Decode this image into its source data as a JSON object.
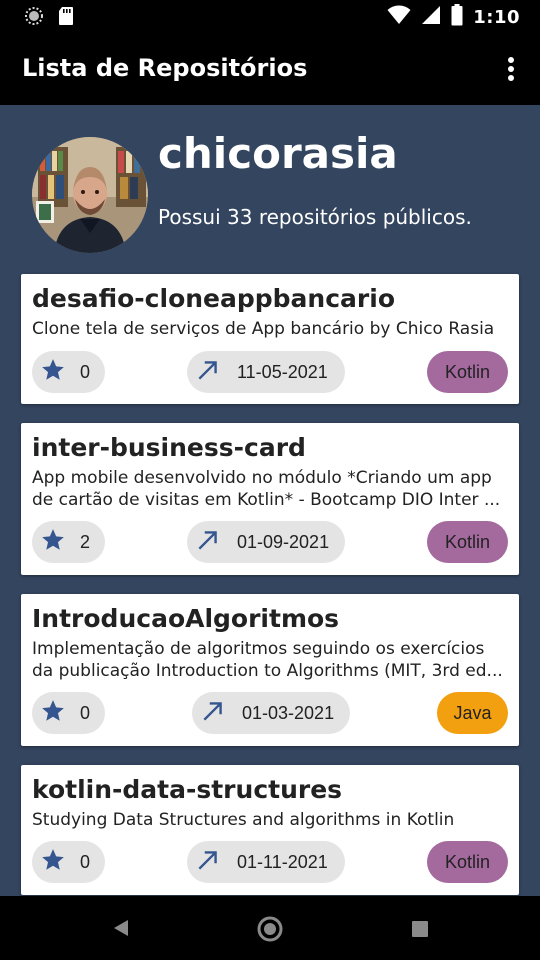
{
  "status_bar": {
    "time": "1:10",
    "icons": [
      "record-circle-icon",
      "sd-card-icon",
      "wifi-icon",
      "signal-icon",
      "battery-icon"
    ]
  },
  "app_bar": {
    "title": "Lista de Repositórios",
    "menu_icon": "more-vert-icon"
  },
  "profile": {
    "username": "chicorasia",
    "repo_count_text": "Possui 33 repositórios públicos."
  },
  "colors": {
    "background": "#34455f",
    "star": "#34558f",
    "kotlin": "#a46a9e",
    "java": "#f29f10",
    "chip_grey": "#e4e4e4"
  },
  "repos": [
    {
      "name": "desafio-cloneappbancario",
      "description": "Clone tela de serviços de App bancário by Chico Rasia",
      "stars": "0",
      "date": "11-05-2021",
      "language": "Kotlin"
    },
    {
      "name": "inter-business-card",
      "description": "App mobile desenvolvido no módulo *Criando um app de cartão de visitas em Kotlin* - Bootcamp DIO Inter ...",
      "stars": "2",
      "date": "01-09-2021",
      "language": "Kotlin"
    },
    {
      "name": "IntroducaoAlgoritmos",
      "description": "Implementação de algoritmos seguindo os exercícios da publicação Introduction to Algorithms (MIT, 3rd ed...",
      "stars": "0",
      "date": "01-03-2021",
      "language": "Java"
    },
    {
      "name": "kotlin-data-structures",
      "description": "Studying Data Structures and algorithms in Kotlin",
      "stars": "0",
      "date": "01-11-2021",
      "language": "Kotlin"
    }
  ],
  "nav_bar": {
    "back_icon": "back-triangle-icon",
    "home_icon": "home-circle-icon",
    "recents_icon": "recents-square-icon"
  }
}
